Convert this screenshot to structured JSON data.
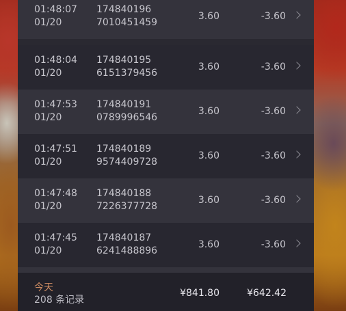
{
  "records": [
    {
      "time": "01:48:07",
      "date": "01/20",
      "order_line1": "174840196",
      "order_line2": "7010451459",
      "amount": "3.60",
      "change": "-3.60"
    },
    {
      "time": "01:48:04",
      "date": "01/20",
      "order_line1": "174840195",
      "order_line2": "6151379456",
      "amount": "3.60",
      "change": "-3.60"
    },
    {
      "time": "01:47:53",
      "date": "01/20",
      "order_line1": "174840191",
      "order_line2": "0789996546",
      "amount": "3.60",
      "change": "-3.60"
    },
    {
      "time": "01:47:51",
      "date": "01/20",
      "order_line1": "174840189",
      "order_line2": "9574409728",
      "amount": "3.60",
      "change": "-3.60"
    },
    {
      "time": "01:47:48",
      "date": "01/20",
      "order_line1": "174840188",
      "order_line2": "7226377728",
      "amount": "3.60",
      "change": "-3.60"
    },
    {
      "time": "01:47:45",
      "date": "01/20",
      "order_line1": "174840187",
      "order_line2": "6241488896",
      "amount": "3.60",
      "change": "-3.60"
    }
  ],
  "footer": {
    "today_label": "今天",
    "record_count": "208 条记录",
    "total": "¥841.80",
    "net": "¥642.42"
  },
  "icons": {
    "row_action": "chevron-right-icon"
  },
  "colors": {
    "today_accent": "#c98961",
    "panel_bg": "#2a2931"
  }
}
